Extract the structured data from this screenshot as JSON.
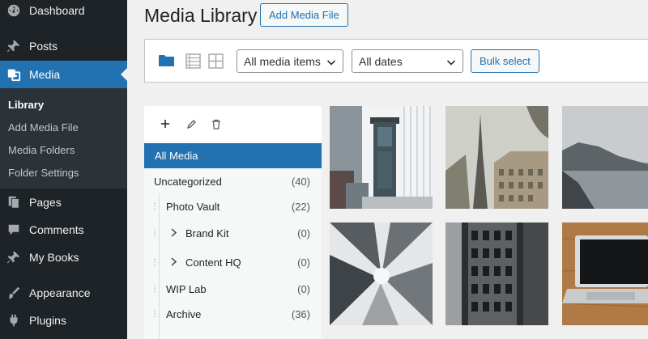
{
  "sidebar": {
    "items": [
      {
        "label": "Dashboard",
        "icon": "dashboard-icon"
      },
      {
        "label": "Posts",
        "icon": "pin-icon"
      },
      {
        "label": "Media",
        "icon": "media-icon"
      },
      {
        "label": "Pages",
        "icon": "pages-icon"
      },
      {
        "label": "Comments",
        "icon": "comments-icon"
      },
      {
        "label": "My Books",
        "icon": "pin-icon"
      },
      {
        "label": "Appearance",
        "icon": "brush-icon"
      },
      {
        "label": "Plugins",
        "icon": "plugin-icon"
      }
    ],
    "submenu": [
      "Library",
      "Add Media File",
      "Media Folders",
      "Folder Settings"
    ]
  },
  "header": {
    "title": "Media Library",
    "add_button": "Add Media File"
  },
  "toolbar": {
    "filter_type": "All media items",
    "filter_date": "All dates",
    "bulk_button": "Bulk select"
  },
  "folders": {
    "all_media": "All Media",
    "rows": [
      {
        "label": "Uncategorized",
        "count": "(40)"
      },
      {
        "label": "Photo Vault",
        "count": "(22)"
      },
      {
        "label": "Brand Kit",
        "count": "(0)"
      },
      {
        "label": "Content HQ",
        "count": "(0)"
      },
      {
        "label": "WIP Lab",
        "count": "(0)"
      },
      {
        "label": "Archive",
        "count": "(36)"
      }
    ]
  },
  "colors": {
    "accent": "#2271b1",
    "sidebar_bg": "#1d2327",
    "submenu_bg": "#2c3338"
  }
}
